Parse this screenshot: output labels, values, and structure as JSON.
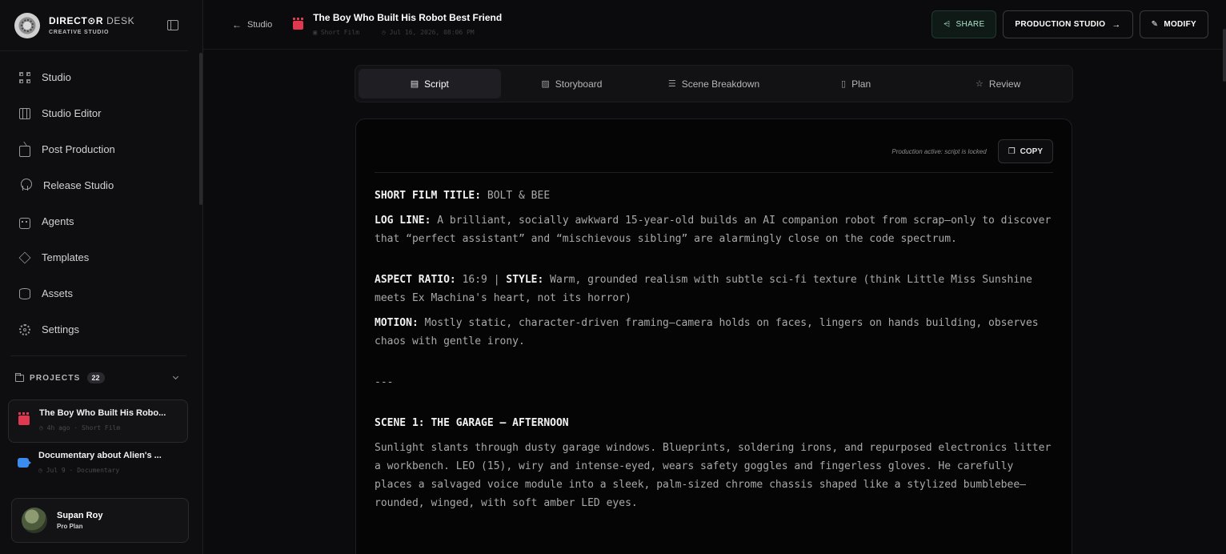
{
  "brand": {
    "name_bold": "DIRECT⊙R",
    "name_light": " DESK",
    "subtitle": "CREATIVE STUDIO"
  },
  "nav": [
    {
      "label": "Studio",
      "icon": "grid-icon"
    },
    {
      "label": "Studio Editor",
      "icon": "film-icon"
    },
    {
      "label": "Post Production",
      "icon": "tv-icon"
    },
    {
      "label": "Release Studio",
      "icon": "award-icon"
    },
    {
      "label": "Agents",
      "icon": "bot-icon"
    },
    {
      "label": "Templates",
      "icon": "layers-icon"
    },
    {
      "label": "Assets",
      "icon": "database-icon"
    },
    {
      "label": "Settings",
      "icon": "gear-icon"
    }
  ],
  "projects": {
    "heading": "PROJECTS",
    "count": "22",
    "items": [
      {
        "title": "The Boy Who Built His Robo...",
        "time": "4h ago",
        "type": "Short Film",
        "color": "#e0394f"
      },
      {
        "title": "Documentary about Alien's ...",
        "time": "Jul 9",
        "type": "Documentary",
        "color": "#3c8cf0"
      }
    ]
  },
  "user": {
    "name": "Supan Roy",
    "plan": "Pro Plan"
  },
  "header": {
    "back_label": "Studio",
    "title": "The Boy Who Built His Robot Best Friend",
    "type": "Short Film",
    "date": "Jul 16, 2026, 08:06 PM"
  },
  "actions": {
    "share": "SHARE",
    "production": "PRODUCTION STUDIO",
    "modify": "MODIFY"
  },
  "tabs": [
    {
      "label": "Script",
      "icon": "file-icon",
      "active": true
    },
    {
      "label": "Storyboard",
      "icon": "image-icon",
      "active": false
    },
    {
      "label": "Scene Breakdown",
      "icon": "list-icon",
      "active": false
    },
    {
      "label": "Plan",
      "icon": "clipboard-icon",
      "active": false
    },
    {
      "label": "Review",
      "icon": "star-icon",
      "active": false
    }
  ],
  "doc": {
    "locked_note": "Production active: script is locked",
    "copy_label": "COPY",
    "title_key": "SHORT FILM TITLE:",
    "title_val": "BOLT & BEE",
    "logline_key": "LOG LINE:",
    "logline_val": "A brilliant, socially awkward 15-year-old builds an AI companion robot from scrap—only to discover that “perfect assistant” and “mischievous sibling” are alarmingly close on the code spectrum.",
    "aspect_key": "ASPECT RATIO:",
    "aspect_val": "16:9",
    "style_key": "STYLE:",
    "style_val": "Warm, grounded realism with subtle sci-fi texture (think Little Miss Sunshine meets Ex Machina's heart, not its horror)",
    "motion_key": "MOTION:",
    "motion_val": "Mostly static, character-driven framing—camera holds on faces, lingers on hands building, observes chaos with gentle irony.",
    "separator": "---",
    "scene_heading": "SCENE 1: THE GARAGE — AFTERNOON",
    "scene_text": "Sunlight slants through dusty garage windows. Blueprints, soldering irons, and repurposed electronics litter a workbench. LEO (15), wiry and intense-eyed, wears safety goggles and fingerless gloves. He carefully places a salvaged voice module into a sleek, palm-sized chrome chassis shaped like a stylized bumblebee—rounded, winged, with soft amber LED eyes."
  }
}
